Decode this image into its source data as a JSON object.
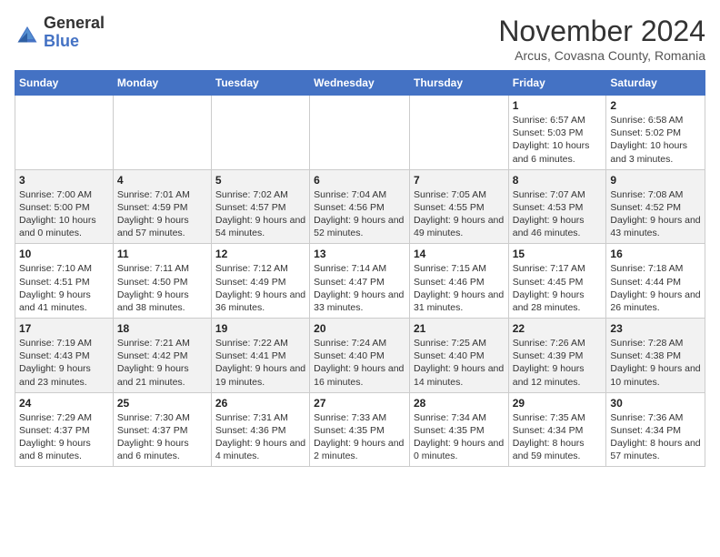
{
  "logo": {
    "line1": "General",
    "line2": "Blue"
  },
  "title": "November 2024",
  "subtitle": "Arcus, Covasna County, Romania",
  "days_of_week": [
    "Sunday",
    "Monday",
    "Tuesday",
    "Wednesday",
    "Thursday",
    "Friday",
    "Saturday"
  ],
  "weeks": [
    [
      {
        "day": "",
        "info": ""
      },
      {
        "day": "",
        "info": ""
      },
      {
        "day": "",
        "info": ""
      },
      {
        "day": "",
        "info": ""
      },
      {
        "day": "",
        "info": ""
      },
      {
        "day": "1",
        "info": "Sunrise: 6:57 AM\nSunset: 5:03 PM\nDaylight: 10 hours and 6 minutes."
      },
      {
        "day": "2",
        "info": "Sunrise: 6:58 AM\nSunset: 5:02 PM\nDaylight: 10 hours and 3 minutes."
      }
    ],
    [
      {
        "day": "3",
        "info": "Sunrise: 7:00 AM\nSunset: 5:00 PM\nDaylight: 10 hours and 0 minutes."
      },
      {
        "day": "4",
        "info": "Sunrise: 7:01 AM\nSunset: 4:59 PM\nDaylight: 9 hours and 57 minutes."
      },
      {
        "day": "5",
        "info": "Sunrise: 7:02 AM\nSunset: 4:57 PM\nDaylight: 9 hours and 54 minutes."
      },
      {
        "day": "6",
        "info": "Sunrise: 7:04 AM\nSunset: 4:56 PM\nDaylight: 9 hours and 52 minutes."
      },
      {
        "day": "7",
        "info": "Sunrise: 7:05 AM\nSunset: 4:55 PM\nDaylight: 9 hours and 49 minutes."
      },
      {
        "day": "8",
        "info": "Sunrise: 7:07 AM\nSunset: 4:53 PM\nDaylight: 9 hours and 46 minutes."
      },
      {
        "day": "9",
        "info": "Sunrise: 7:08 AM\nSunset: 4:52 PM\nDaylight: 9 hours and 43 minutes."
      }
    ],
    [
      {
        "day": "10",
        "info": "Sunrise: 7:10 AM\nSunset: 4:51 PM\nDaylight: 9 hours and 41 minutes."
      },
      {
        "day": "11",
        "info": "Sunrise: 7:11 AM\nSunset: 4:50 PM\nDaylight: 9 hours and 38 minutes."
      },
      {
        "day": "12",
        "info": "Sunrise: 7:12 AM\nSunset: 4:49 PM\nDaylight: 9 hours and 36 minutes."
      },
      {
        "day": "13",
        "info": "Sunrise: 7:14 AM\nSunset: 4:47 PM\nDaylight: 9 hours and 33 minutes."
      },
      {
        "day": "14",
        "info": "Sunrise: 7:15 AM\nSunset: 4:46 PM\nDaylight: 9 hours and 31 minutes."
      },
      {
        "day": "15",
        "info": "Sunrise: 7:17 AM\nSunset: 4:45 PM\nDaylight: 9 hours and 28 minutes."
      },
      {
        "day": "16",
        "info": "Sunrise: 7:18 AM\nSunset: 4:44 PM\nDaylight: 9 hours and 26 minutes."
      }
    ],
    [
      {
        "day": "17",
        "info": "Sunrise: 7:19 AM\nSunset: 4:43 PM\nDaylight: 9 hours and 23 minutes."
      },
      {
        "day": "18",
        "info": "Sunrise: 7:21 AM\nSunset: 4:42 PM\nDaylight: 9 hours and 21 minutes."
      },
      {
        "day": "19",
        "info": "Sunrise: 7:22 AM\nSunset: 4:41 PM\nDaylight: 9 hours and 19 minutes."
      },
      {
        "day": "20",
        "info": "Sunrise: 7:24 AM\nSunset: 4:40 PM\nDaylight: 9 hours and 16 minutes."
      },
      {
        "day": "21",
        "info": "Sunrise: 7:25 AM\nSunset: 4:40 PM\nDaylight: 9 hours and 14 minutes."
      },
      {
        "day": "22",
        "info": "Sunrise: 7:26 AM\nSunset: 4:39 PM\nDaylight: 9 hours and 12 minutes."
      },
      {
        "day": "23",
        "info": "Sunrise: 7:28 AM\nSunset: 4:38 PM\nDaylight: 9 hours and 10 minutes."
      }
    ],
    [
      {
        "day": "24",
        "info": "Sunrise: 7:29 AM\nSunset: 4:37 PM\nDaylight: 9 hours and 8 minutes."
      },
      {
        "day": "25",
        "info": "Sunrise: 7:30 AM\nSunset: 4:37 PM\nDaylight: 9 hours and 6 minutes."
      },
      {
        "day": "26",
        "info": "Sunrise: 7:31 AM\nSunset: 4:36 PM\nDaylight: 9 hours and 4 minutes."
      },
      {
        "day": "27",
        "info": "Sunrise: 7:33 AM\nSunset: 4:35 PM\nDaylight: 9 hours and 2 minutes."
      },
      {
        "day": "28",
        "info": "Sunrise: 7:34 AM\nSunset: 4:35 PM\nDaylight: 9 hours and 0 minutes."
      },
      {
        "day": "29",
        "info": "Sunrise: 7:35 AM\nSunset: 4:34 PM\nDaylight: 8 hours and 59 minutes."
      },
      {
        "day": "30",
        "info": "Sunrise: 7:36 AM\nSunset: 4:34 PM\nDaylight: 8 hours and 57 minutes."
      }
    ]
  ]
}
